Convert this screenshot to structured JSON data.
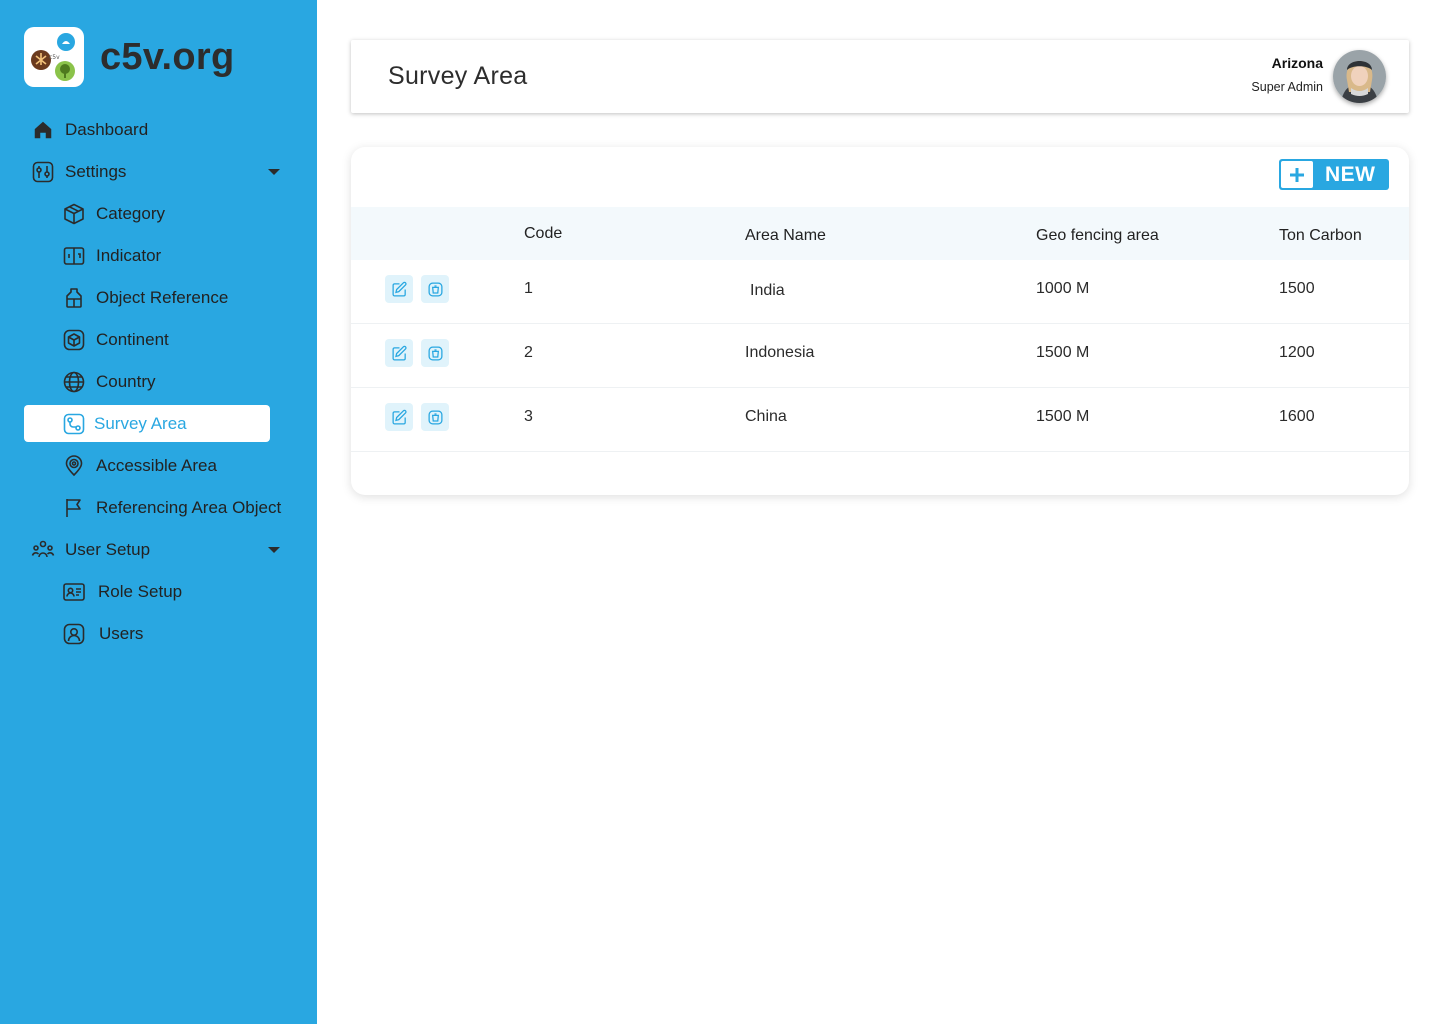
{
  "brand": {
    "name": "c5v.org",
    "logo_text": "c5v"
  },
  "sidebar": {
    "items": [
      {
        "label": "Dashboard",
        "icon": "home-icon"
      },
      {
        "label": "Settings",
        "icon": "settings-sliders-icon",
        "expandable": true
      },
      {
        "label": "Category",
        "icon": "cube-icon"
      },
      {
        "label": "Indicator",
        "icon": "indicator-icon"
      },
      {
        "label": "Object Reference",
        "icon": "jar-icon"
      },
      {
        "label": "Continent",
        "icon": "continent-cube-icon"
      },
      {
        "label": "Country",
        "icon": "globe-icon"
      },
      {
        "label": "Survey Area",
        "icon": "route-icon",
        "active": true
      },
      {
        "label": "Accessible Area",
        "icon": "location-pin-icon"
      },
      {
        "label": "Referencing Area Object",
        "icon": "flag-icon"
      },
      {
        "label": "User Setup",
        "icon": "users-group-icon",
        "expandable": true
      },
      {
        "label": "Role Setup",
        "icon": "id-card-icon"
      },
      {
        "label": "Users",
        "icon": "user-circle-icon"
      }
    ]
  },
  "header": {
    "title": "Survey Area",
    "user_name": "Arizona",
    "user_role": "Super Admin"
  },
  "toolbar": {
    "new_label": "NEW"
  },
  "table": {
    "columns": [
      "Code",
      "Area Name",
      "Geo fencing area",
      "Ton Carbon"
    ],
    "rows": [
      {
        "code": "1",
        "area_name": "India",
        "geo_fencing": "1000 M",
        "ton_carbon": "1500"
      },
      {
        "code": "2",
        "area_name": "Indonesia",
        "geo_fencing": "1500 M",
        "ton_carbon": "1200"
      },
      {
        "code": "3",
        "area_name": "China",
        "geo_fencing": "1500 M",
        "ton_carbon": "1600"
      }
    ]
  },
  "colors": {
    "accent": "#29a7e1",
    "sidebar_bg": "#29a7e1",
    "table_header_bg": "#f3f9fc",
    "action_bg": "#e0f3fb"
  }
}
